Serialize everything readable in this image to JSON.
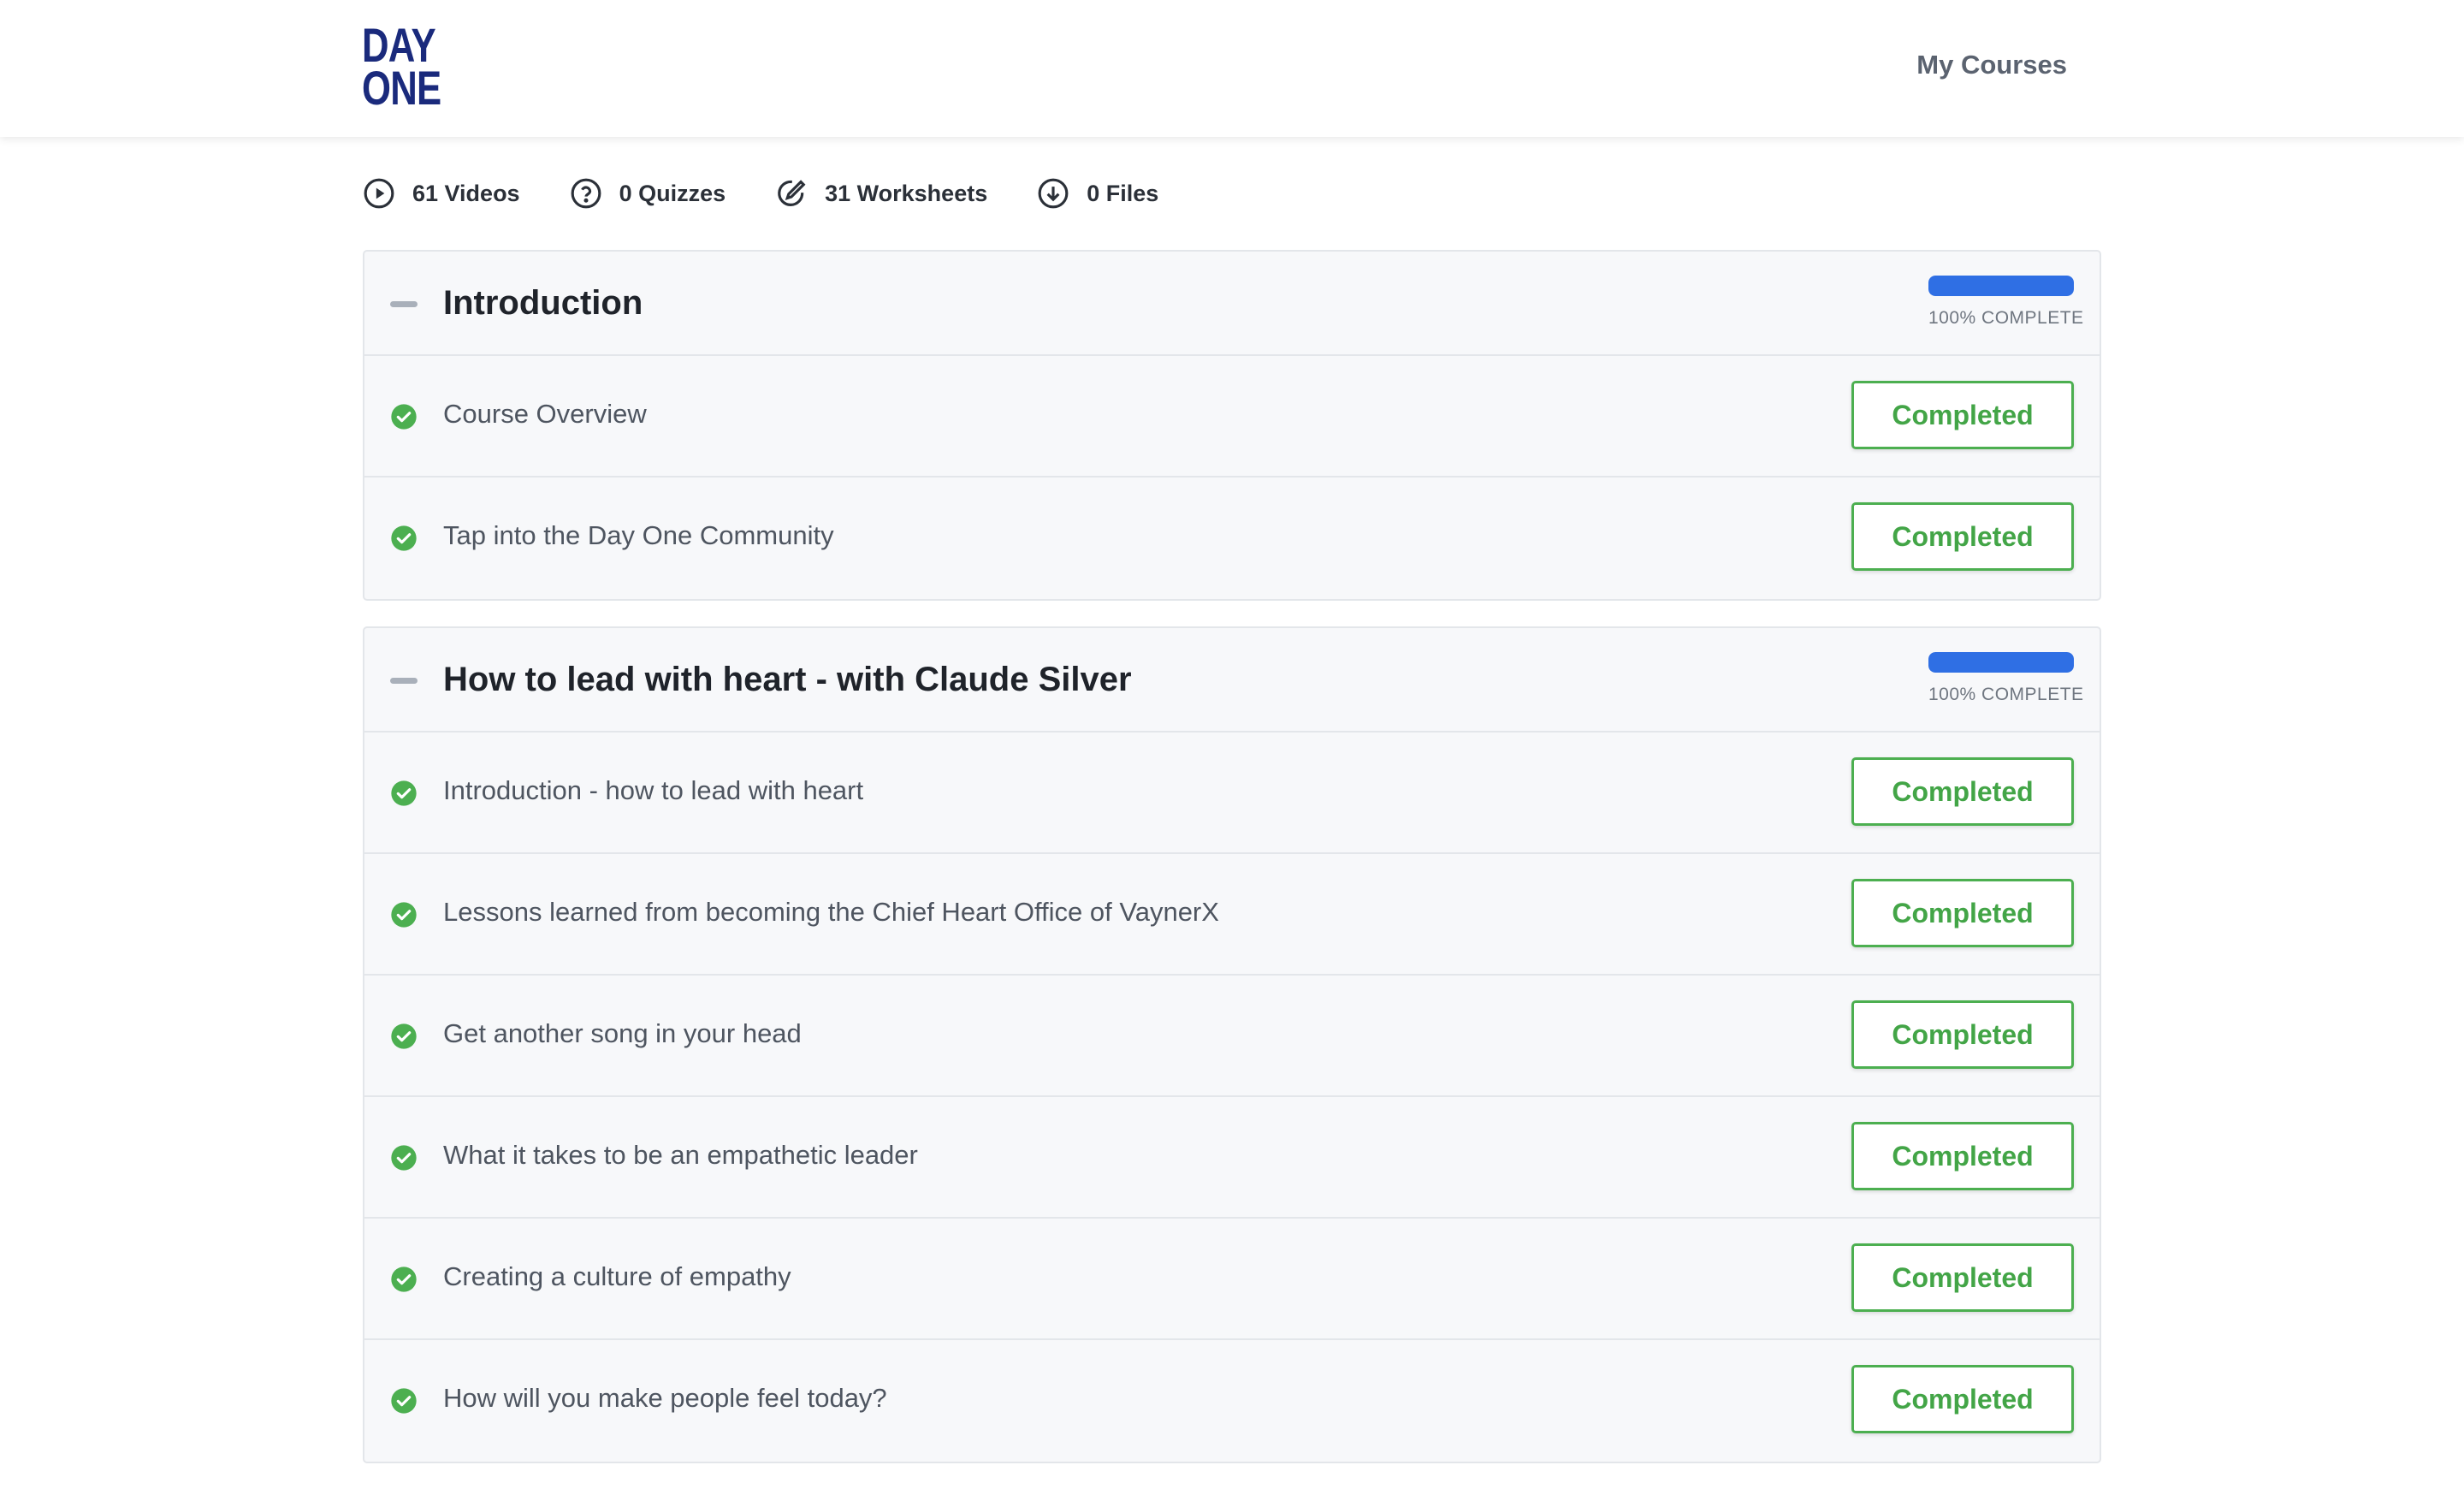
{
  "header": {
    "logo": {
      "line1": "DAY",
      "line2": "ONE"
    },
    "nav_link": "My Courses"
  },
  "stats": [
    {
      "icon": "play-circle-icon",
      "label": "61 Videos"
    },
    {
      "icon": "question-circle-icon",
      "label": "0 Quizzes"
    },
    {
      "icon": "pencil-circle-icon",
      "label": "31 Worksheets"
    },
    {
      "icon": "download-circle-icon",
      "label": "0 Files"
    }
  ],
  "colors": {
    "brand": "#1a2a7c",
    "progress": "#2f6fe4",
    "success": "#4caf50"
  },
  "sections": [
    {
      "title": "Introduction",
      "progress": 100,
      "progress_label": "100% COMPLETE",
      "lessons": [
        {
          "title": "Course Overview",
          "status": "Completed"
        },
        {
          "title": "Tap into the Day One Community",
          "status": "Completed"
        }
      ]
    },
    {
      "title": "How to lead with heart - with Claude Silver",
      "progress": 100,
      "progress_label": "100% COMPLETE",
      "lessons": [
        {
          "title": "Introduction - how to lead with heart",
          "status": "Completed"
        },
        {
          "title": "Lessons learned from becoming the Chief Heart Office of VaynerX",
          "status": "Completed"
        },
        {
          "title": "Get another song in your head",
          "status": "Completed"
        },
        {
          "title": "What it takes to be an empathetic leader",
          "status": "Completed"
        },
        {
          "title": "Creating a culture of empathy",
          "status": "Completed"
        },
        {
          "title": "How will you make people feel today?",
          "status": "Completed"
        }
      ]
    }
  ]
}
